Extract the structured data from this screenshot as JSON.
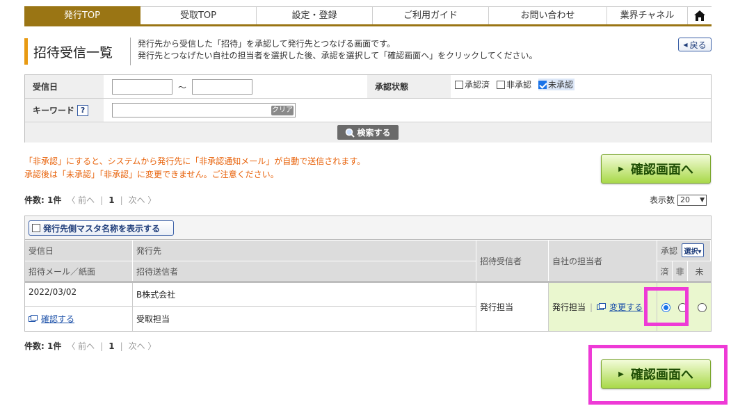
{
  "nav": {
    "items": [
      {
        "label": "発行TOP"
      },
      {
        "label": "受取TOP"
      },
      {
        "label": "設定・登録"
      },
      {
        "label": "ご利用ガイド"
      },
      {
        "label": "お問い合わせ"
      },
      {
        "label": "業界チャネル"
      }
    ],
    "home_icon": "home-icon"
  },
  "header": {
    "title": "招待受信一覧",
    "desc1": "発行先から受信した「招待」を承認して発行先とつなげる画面です。",
    "desc2": "発行先とつなげたい自社の担当者を選択した後、承認を選択して「確認画面へ」をクリックしてください。",
    "back_label": "戻る"
  },
  "search": {
    "received_date_label": "受信日",
    "date_from": "",
    "range_sep": "～",
    "date_to": "",
    "status_label": "承認状態",
    "status_options": [
      {
        "label": "承認済",
        "checked": false
      },
      {
        "label": "非承認",
        "checked": false
      },
      {
        "label": "未承認",
        "checked": true
      }
    ],
    "keyword_label": "キーワード",
    "keyword_help": "?",
    "keyword_value": "",
    "clear_label": "クリア",
    "search_label": "検索する"
  },
  "warning": {
    "line1": "「非承認」にすると、システムから発行先に「非承認通知メール」が自動で送信されます。",
    "line2": "承認後は「未承認」「非承認」に変更できません。ご注意ください。"
  },
  "confirm_label": "確認画面へ",
  "pager": {
    "count": "件数: 1件",
    "prev": "〈 前へ",
    "page": "1",
    "next": "次へ 〉",
    "per_page_label": "表示数",
    "per_page_value": "20"
  },
  "table": {
    "master_label": "発行先側マスタ名称を表示する",
    "headers": {
      "received_date": "受信日",
      "issuer": "発行先",
      "invite_mail": "招待メール／紙面",
      "invite_sender": "招待送信者",
      "invite_receiver": "招待受信者",
      "our_staff": "自社の担当者",
      "approval": "承認",
      "select": "選択▾",
      "done": "済",
      "rejected": "非",
      "pending": "未"
    },
    "rows": [
      {
        "date": "2022/03/02",
        "issuer": "B株式会社",
        "confirm_link": "確認する",
        "sender": "受取担当",
        "receiver": "発行担当",
        "staff": "発行担当",
        "change_link": "変更する",
        "approval_selected": "済"
      }
    ]
  },
  "colors": {
    "nav_active": "#9a7514",
    "accent_orange": "#e89a12",
    "warning_text": "#e8620a",
    "confirm_green": "#a9d94a",
    "highlight": "#ee3ad6",
    "link_blue": "#1a4fa8"
  }
}
